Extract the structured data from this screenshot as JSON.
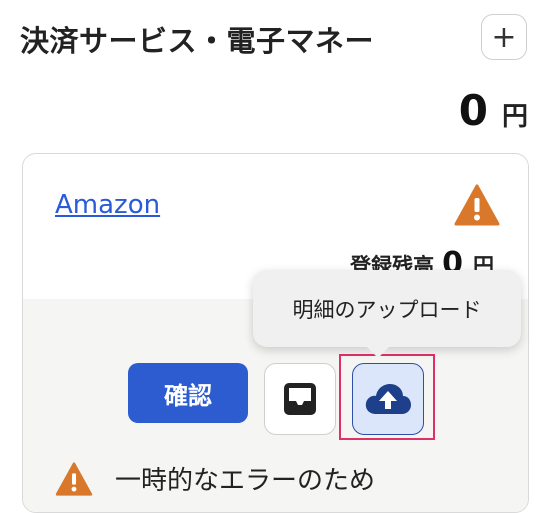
{
  "section": {
    "title": "決済サービス・電子マネー",
    "add_label": "+"
  },
  "total": {
    "amount": "0",
    "unit": "円"
  },
  "card": {
    "service_name": "Amazon",
    "balance_label": "登録残高",
    "balance_value": "0",
    "balance_unit": "円",
    "confirm_label": "確認",
    "error_message": "一時的なエラーのため"
  },
  "tooltip": {
    "text": "明細のアップロード"
  },
  "colors": {
    "accent_blue": "#2d5bd0",
    "link_blue": "#2a5bd7",
    "warning_orange": "#d9782b",
    "highlight_pink": "#e0306a",
    "upload_bg": "#dbe6fb",
    "cloud_navy": "#1e3f8a"
  },
  "icons": [
    "plus-icon",
    "warning-icon",
    "inbox-icon",
    "cloud-upload-icon"
  ]
}
